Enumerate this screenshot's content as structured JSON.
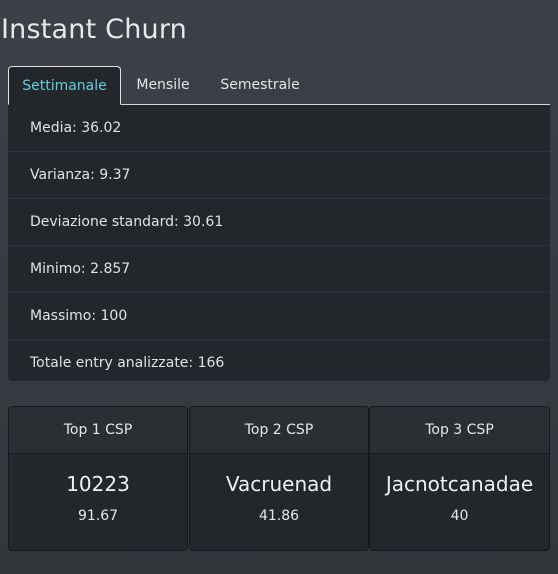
{
  "title": "Instant Churn",
  "tabs": [
    {
      "label": "Settimanale",
      "active": true
    },
    {
      "label": "Mensile",
      "active": false
    },
    {
      "label": "Semestrale",
      "active": false
    }
  ],
  "stats": {
    "media": "Media: 36.02",
    "varianza": "Varianza: 9.37",
    "deviazione": "Deviazione standard: 30.61",
    "minimo": "Minimo: 2.857",
    "massimo": "Massimo: 100",
    "totale": "Totale entry analizzate: 166"
  },
  "top_csp": [
    {
      "header": "Top 1 CSP",
      "name": "10223",
      "value": "91.67"
    },
    {
      "header": "Top 2 CSP",
      "name": "Vacruenad",
      "value": "41.86"
    },
    {
      "header": "Top 3 CSP",
      "name": "Jacnotcanadae",
      "value": "40"
    }
  ],
  "colors": {
    "accent": "#5fd1d9",
    "panel": "#23262b",
    "background": "#3d4047"
  }
}
